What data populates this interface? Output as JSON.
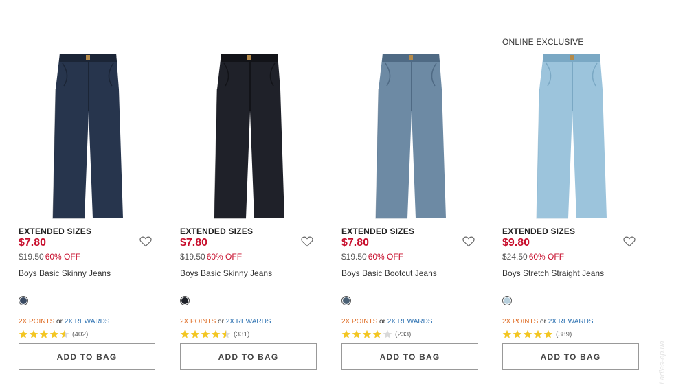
{
  "colors": {
    "sale_red": "#c8102e",
    "points_orange": "#e0702a",
    "rewards_blue": "#2a6fb0",
    "star_gold": "#f3c623",
    "star_empty": "#d9d9d9"
  },
  "products": [
    {
      "badge": "",
      "tag": "EXTENDED SIZES",
      "price": "$7.80",
      "was_price": "$19.50",
      "discount": "60% OFF",
      "name": "Boys Basic Skinny Jeans",
      "swatch_color": "#3a4a62",
      "jeans_color": "#27354d",
      "jeans_shade": "#1b2536",
      "points_label": "2X POINTS",
      "or_label": "or",
      "rewards_label": "2X REWARDS",
      "rating": 4.5,
      "review_count": "(402)",
      "button_label": "ADD TO BAG",
      "heart_icon": "heart-outline-icon"
    },
    {
      "badge": "",
      "tag": "EXTENDED SIZES",
      "price": "$7.80",
      "was_price": "$19.50",
      "discount": "60% OFF",
      "name": "Boys Basic Skinny Jeans",
      "swatch_color": "#1e2128",
      "jeans_color": "#1f2129",
      "jeans_shade": "#121318",
      "points_label": "2X POINTS",
      "or_label": "or",
      "rewards_label": "2X REWARDS",
      "rating": 4.5,
      "review_count": "(331)",
      "button_label": "ADD TO BAG",
      "heart_icon": "heart-outline-icon"
    },
    {
      "badge": "",
      "tag": "EXTENDED SIZES",
      "price": "$7.80",
      "was_price": "$19.50",
      "discount": "60% OFF",
      "name": "Boys Basic Bootcut Jeans",
      "swatch_color": "#4a6074",
      "jeans_color": "#6d8aa4",
      "jeans_shade": "#4f6a84",
      "points_label": "2X POINTS",
      "or_label": "or",
      "rewards_label": "2X REWARDS",
      "rating": 4,
      "review_count": "(233)",
      "button_label": "ADD TO BAG",
      "heart_icon": "heart-outline-icon"
    },
    {
      "badge": "ONLINE EXCLUSIVE",
      "tag": "EXTENDED SIZES",
      "price": "$9.80",
      "was_price": "$24.50",
      "discount": "60% OFF",
      "name": "Boys Stretch Straight Jeans",
      "swatch_color": "#b7cfdc",
      "jeans_color": "#9cc4dc",
      "jeans_shade": "#7aa8c4",
      "points_label": "2X POINTS",
      "or_label": "or",
      "rewards_label": "2X REWARDS",
      "rating": 5,
      "review_count": "(389)",
      "button_label": "ADD TO BAG",
      "heart_icon": "heart-outline-icon"
    }
  ],
  "watermark": "Ladies-ep.ua"
}
